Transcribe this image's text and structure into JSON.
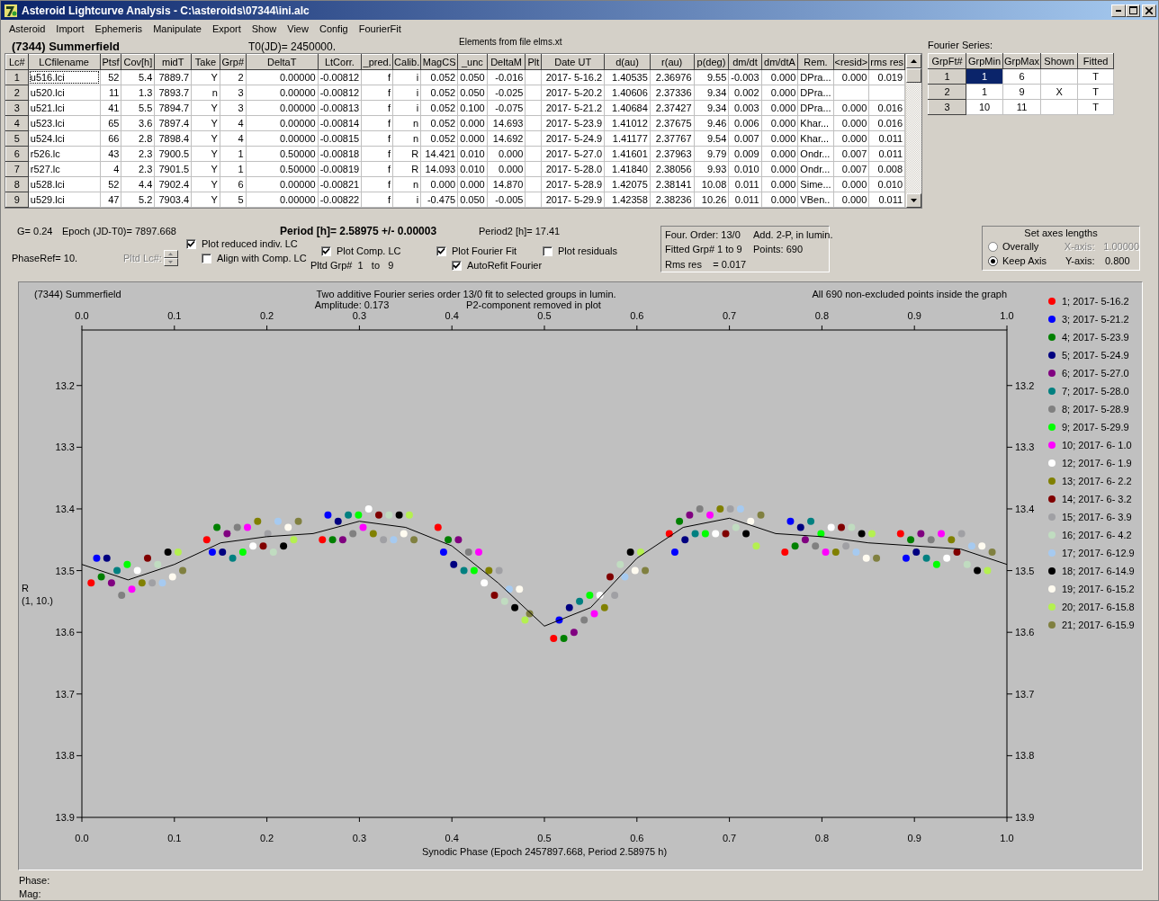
{
  "window": {
    "title": "Asteroid Lightcurve Analysis - C:\\asteroids\\07344\\ini.alc"
  },
  "menu": [
    "Asteroid",
    "Import",
    "Ephemeris",
    "Manipulate",
    "Export",
    "Show",
    "View",
    "Config",
    "FourierFit"
  ],
  "header": {
    "object": "(7344) Summerfield",
    "t0": "T0(JD)= 2450000.",
    "elements": "Elements from file elms.xt"
  },
  "lc_table": {
    "columns": [
      "Lc#",
      "LCfilename",
      "Ptsf",
      "Cov[h]",
      "midT",
      "Take",
      "Grp#",
      "DeltaT",
      "LtCorr.",
      "_pred.",
      "Calib.",
      "MagCS",
      "_unc",
      "DeltaM",
      "Plt",
      "Date UT",
      "d(au)",
      "r(au)",
      "p(deg)",
      "dm/dt",
      "dm/dtA",
      "Rem.",
      "<resid>",
      "rms res"
    ],
    "rows": [
      {
        "focused": true,
        "cells": [
          "1",
          "u516.lci",
          "52",
          "5.4",
          "7889.7",
          "Y",
          "2",
          "0.00000",
          "-0.00812",
          "f",
          "i",
          "0.052",
          "0.050",
          "-0.016",
          "",
          "2017- 5-16.2",
          "1.40535",
          "2.36976",
          "9.55",
          "-0.003",
          "0.000",
          "DPra...",
          "0.000",
          "0.019"
        ]
      },
      {
        "focused": false,
        "cells": [
          "2",
          "u520.lci",
          "11",
          "1.3",
          "7893.7",
          "n",
          "3",
          "0.00000",
          "-0.00812",
          "f",
          "i",
          "0.052",
          "0.050",
          "-0.025",
          "",
          "2017- 5-20.2",
          "1.40606",
          "2.37336",
          "9.34",
          "0.002",
          "0.000",
          "DPra..."
        ]
      },
      {
        "focused": false,
        "cells": [
          "3",
          "u521.lci",
          "41",
          "5.5",
          "7894.7",
          "Y",
          "3",
          "0.00000",
          "-0.00813",
          "f",
          "i",
          "0.052",
          "0.100",
          "-0.075",
          "",
          "2017- 5-21.2",
          "1.40684",
          "2.37427",
          "9.34",
          "0.003",
          "0.000",
          "DPra...",
          "0.000",
          "0.016"
        ]
      },
      {
        "focused": false,
        "cells": [
          "4",
          "u523.lci",
          "65",
          "3.6",
          "7897.4",
          "Y",
          "4",
          "0.00000",
          "-0.00814",
          "f",
          "n",
          "0.052",
          "0.000",
          "14.693",
          "",
          "2017- 5-23.9",
          "1.41012",
          "2.37675",
          "9.46",
          "0.006",
          "0.000",
          "Khar...",
          "0.000",
          "0.016"
        ]
      },
      {
        "focused": false,
        "cells": [
          "5",
          "u524.lci",
          "66",
          "2.8",
          "7898.4",
          "Y",
          "4",
          "0.00000",
          "-0.00815",
          "f",
          "n",
          "0.052",
          "0.000",
          "14.692",
          "",
          "2017- 5-24.9",
          "1.41177",
          "2.37767",
          "9.54",
          "0.007",
          "0.000",
          "Khar...",
          "0.000",
          "0.011"
        ]
      },
      {
        "focused": false,
        "cells": [
          "6",
          "r526.lc",
          "43",
          "2.3",
          "7900.5",
          "Y",
          "1",
          "0.50000",
          "-0.00818",
          "f",
          "R",
          "14.421",
          "0.010",
          "0.000",
          "",
          "2017- 5-27.0",
          "1.41601",
          "2.37963",
          "9.79",
          "0.009",
          "0.000",
          "Ondr...",
          "0.007",
          "0.011"
        ]
      },
      {
        "focused": false,
        "cells": [
          "7",
          "r527.lc",
          "4",
          "2.3",
          "7901.5",
          "Y",
          "1",
          "0.50000",
          "-0.00819",
          "f",
          "R",
          "14.093",
          "0.010",
          "0.000",
          "",
          "2017- 5-28.0",
          "1.41840",
          "2.38056",
          "9.93",
          "0.010",
          "0.000",
          "Ondr...",
          "0.007",
          "0.008"
        ]
      },
      {
        "focused": false,
        "cells": [
          "8",
          "u528.lci",
          "52",
          "4.4",
          "7902.4",
          "Y",
          "6",
          "0.00000",
          "-0.00821",
          "f",
          "n",
          "0.000",
          "0.000",
          "14.870",
          "",
          "2017- 5-28.9",
          "1.42075",
          "2.38141",
          "10.08",
          "0.011",
          "0.000",
          "Sime...",
          "0.000",
          "0.010"
        ]
      },
      {
        "focused": false,
        "cells": [
          "9",
          "u529.lci",
          "47",
          "5.2",
          "7903.4",
          "Y",
          "5",
          "0.00000",
          "-0.00822",
          "f",
          "i",
          "-0.475",
          "0.050",
          "-0.005",
          "",
          "2017- 5-29.9",
          "1.42358",
          "2.38236",
          "10.26",
          "0.011",
          "0.000",
          "VBen..",
          "0.000",
          "0.011"
        ]
      }
    ]
  },
  "fourier": {
    "label": "Fourier Series:",
    "columns": [
      "GrpFt#",
      "GrpMin",
      "GrpMax",
      "Shown",
      "Fitted"
    ],
    "rows": [
      {
        "num": "1",
        "min": "1",
        "max": "6",
        "fitted": "T",
        "selected": true
      },
      {
        "num": "2",
        "min": "1",
        "max": "9",
        "shown": "X",
        "fitted": "T",
        "selected": false
      },
      {
        "num": "3",
        "min": "10",
        "max": "11",
        "fitted": "T",
        "selected": false
      }
    ]
  },
  "stats": {
    "g": "G= 0.24",
    "epoch": "Epoch (JD-T0)= 7897.668",
    "period": "Period [h]= 2.58975 +/- 0.00003",
    "period2": "Period2 [h]= 17.41",
    "phaseref": "PhaseRef= 10.",
    "pltd_lc": {
      "label": "Pltd Lc#:",
      "disabled": true
    },
    "pltd_grp": "Pltd Grp#  1   to   9"
  },
  "checkboxes": [
    {
      "label": "Plot reduced indiv. LC",
      "checked": true
    },
    {
      "label": "Align with Comp. LC",
      "checked": false
    },
    {
      "label": "Plot Comp. LC",
      "checked": true
    },
    {
      "label": "Plot Fourier Fit",
      "checked": true
    },
    {
      "label": "Plot residuals",
      "checked": false
    },
    {
      "label": "AutoRefit Fourier",
      "checked": true
    }
  ],
  "info": [
    "Four. Order: 13/0",
    "Add. 2-P, in lumin.",
    "Fitted Grp# 1 to 9",
    "Points: 690",
    "Rms res    = 0.017"
  ],
  "axes": {
    "title": "Set axes lengths",
    "options": [
      {
        "label": "Overally",
        "selected": false
      },
      {
        "label": "Keep Axis",
        "selected": true
      }
    ],
    "fields": [
      {
        "label": "X-axis:",
        "value": "1.00000",
        "disabled": true
      },
      {
        "label": "Y-axis:",
        "value": "0.800",
        "disabled": false
      }
    ]
  },
  "panel": {
    "object": "(7344) Summerfield",
    "subtitle": "Amplitude: 0.173",
    "note_center": "P2-component removed in plot",
    "note_right": "All 690 non-excluded points inside the graph",
    "y_note": "(1, 10.)",
    "right_axis_labels": [
      "13.2",
      "13.3",
      "13.4",
      "13.5",
      "13.6",
      "13.7",
      "13.8",
      "13.9"
    ],
    "chart_data": {
      "type": "scatter",
      "title": "Two additive Fourier series order 13/0 fit to selected groups in lumin.",
      "xlabel": "Synodic Phase (Epoch 2457897.668, Period 2.58975 h)",
      "ylabel": "R",
      "legend": true,
      "xlim": [
        0,
        1
      ],
      "ylim": [
        13.9,
        13.11
      ],
      "xticks": [
        {
          "value": 0,
          "label": "0.0"
        },
        {
          "value": 0.1,
          "label": "0.1"
        },
        {
          "value": 0.2,
          "label": "0.2"
        },
        {
          "value": 0.3,
          "label": "0.3"
        },
        {
          "value": 0.4,
          "label": "0.4"
        },
        {
          "value": 0.5,
          "label": "0.5"
        },
        {
          "value": 0.6,
          "label": "0.6"
        },
        {
          "value": 0.7,
          "label": "0.7"
        },
        {
          "value": 0.8,
          "label": "0.8"
        },
        {
          "value": 0.9,
          "label": "0.9"
        },
        {
          "value": 1,
          "label": "1.0"
        }
      ],
      "yticks": [
        {
          "value": 13.2,
          "label": "13.2"
        },
        {
          "value": 13.3,
          "label": "13.3"
        },
        {
          "value": 13.4,
          "label": "13.4"
        },
        {
          "value": 13.5,
          "label": "13.5"
        },
        {
          "value": 13.6,
          "label": "13.6"
        },
        {
          "value": 13.7,
          "label": "13.7"
        },
        {
          "value": 13.8,
          "label": "13.8"
        },
        {
          "value": 13.9,
          "label": "13.9"
        }
      ],
      "series": [
        {
          "name": "1; 2017- 5-16.2",
          "color": "#ff0000",
          "x": [
            0.01,
            0.135,
            0.26,
            0.385,
            0.51,
            0.635,
            0.76,
            0.885
          ],
          "values": [
            13.52,
            13.45,
            13.45,
            13.43,
            13.61,
            13.44,
            13.47,
            13.44
          ]
        },
        {
          "name": "3; 2017- 5-21.2",
          "color": "#0000ff",
          "x": [
            0.016,
            0.141,
            0.266,
            0.391,
            0.516,
            0.641,
            0.766,
            0.891
          ],
          "values": [
            13.48,
            13.47,
            13.41,
            13.47,
            13.58,
            13.47,
            13.42,
            13.48
          ]
        },
        {
          "name": "4; 2017- 5-23.9",
          "color": "#008000",
          "x": [
            0.021,
            0.146,
            0.271,
            0.396,
            0.521,
            0.646,
            0.771,
            0.896
          ],
          "values": [
            13.51,
            13.43,
            13.45,
            13.45,
            13.61,
            13.42,
            13.46,
            13.45
          ]
        },
        {
          "name": "5; 2017- 5-24.9",
          "color": "#000080",
          "x": [
            0.027,
            0.152,
            0.277,
            0.402,
            0.527,
            0.652,
            0.777,
            0.902
          ],
          "values": [
            13.48,
            13.47,
            13.42,
            13.49,
            13.56,
            13.45,
            13.43,
            13.47
          ]
        },
        {
          "name": "6; 2017- 5-27.0",
          "color": "#800080",
          "x": [
            0.032,
            0.157,
            0.282,
            0.407,
            0.532,
            0.657,
            0.782,
            0.907
          ],
          "values": [
            13.52,
            13.44,
            13.45,
            13.45,
            13.6,
            13.41,
            13.45,
            13.44
          ]
        },
        {
          "name": "7; 2017- 5-28.0",
          "color": "#008080",
          "x": [
            0.038,
            0.163,
            0.288,
            0.413,
            0.538,
            0.663,
            0.788,
            0.913
          ],
          "values": [
            13.5,
            13.48,
            13.41,
            13.5,
            13.55,
            13.44,
            13.42,
            13.48
          ]
        },
        {
          "name": "8; 2017- 5-28.9",
          "color": "#808080",
          "x": [
            0.043,
            0.168,
            0.293,
            0.418,
            0.543,
            0.668,
            0.793,
            0.918
          ],
          "values": [
            13.54,
            13.43,
            13.44,
            13.47,
            13.58,
            13.4,
            13.46,
            13.45
          ]
        },
        {
          "name": "9; 2017- 5-29.9",
          "color": "#00ff00",
          "x": [
            0.049,
            0.174,
            0.299,
            0.424,
            0.549,
            0.674,
            0.799,
            0.924
          ],
          "values": [
            13.49,
            13.47,
            13.41,
            13.5,
            13.54,
            13.44,
            13.44,
            13.49
          ]
        },
        {
          "name": "10; 2017- 6- 1.0",
          "color": "#ff00ff",
          "x": [
            0.054,
            0.179,
            0.304,
            0.429,
            0.554,
            0.679,
            0.804,
            0.929
          ],
          "values": [
            13.53,
            13.43,
            13.43,
            13.47,
            13.57,
            13.41,
            13.47,
            13.44
          ]
        },
        {
          "name": "12; 2017- 6- 1.9",
          "color": "#ffffff",
          "x": [
            0.06,
            0.185,
            0.31,
            0.435,
            0.56,
            0.685,
            0.81,
            0.935
          ],
          "values": [
            13.5,
            13.46,
            13.4,
            13.52,
            13.54,
            13.44,
            13.43,
            13.48
          ]
        },
        {
          "name": "13; 2017- 6- 2.2",
          "color": "#808000",
          "x": [
            0.065,
            0.19,
            0.315,
            0.44,
            0.565,
            0.69,
            0.815,
            0.94
          ],
          "values": [
            13.52,
            13.42,
            13.44,
            13.5,
            13.56,
            13.4,
            13.47,
            13.45
          ]
        },
        {
          "name": "14; 2017- 6- 3.2",
          "color": "#800000",
          "x": [
            0.071,
            0.196,
            0.321,
            0.446,
            0.571,
            0.696,
            0.821,
            0.946
          ],
          "values": [
            13.48,
            13.46,
            13.41,
            13.54,
            13.51,
            13.44,
            13.43,
            13.47
          ]
        },
        {
          "name": "15; 2017- 6- 3.9",
          "color": "#a0a0a4",
          "x": [
            0.076,
            0.201,
            0.326,
            0.451,
            0.576,
            0.701,
            0.826,
            0.951
          ],
          "values": [
            13.52,
            13.44,
            13.45,
            13.5,
            13.54,
            13.4,
            13.46,
            13.44
          ]
        },
        {
          "name": "16; 2017- 6- 4.2",
          "color": "#c0dcc0",
          "x": [
            0.082,
            0.207,
            0.332,
            0.457,
            0.582,
            0.707,
            0.832,
            0.957
          ],
          "values": [
            13.49,
            13.47,
            13.41,
            13.55,
            13.49,
            13.43,
            13.43,
            13.49
          ]
        },
        {
          "name": "17; 2017- 6-12.9",
          "color": "#a6caf0",
          "x": [
            0.087,
            0.212,
            0.337,
            0.462,
            0.587,
            0.712,
            0.837,
            0.962
          ],
          "values": [
            13.52,
            13.42,
            13.45,
            13.53,
            13.51,
            13.4,
            13.47,
            13.46
          ]
        },
        {
          "name": "18; 2017- 6-14.9",
          "color": "#000000",
          "x": [
            0.093,
            0.218,
            0.343,
            0.468,
            0.593,
            0.718,
            0.843,
            0.968
          ],
          "values": [
            13.47,
            13.46,
            13.41,
            13.56,
            13.47,
            13.44,
            13.44,
            13.5
          ]
        },
        {
          "name": "19; 2017- 6-15.2",
          "color": "#fffbf0",
          "x": [
            0.098,
            0.223,
            0.348,
            0.473,
            0.598,
            0.723,
            0.848,
            0.973
          ],
          "values": [
            13.51,
            13.43,
            13.44,
            13.53,
            13.5,
            13.42,
            13.48,
            13.46
          ]
        },
        {
          "name": "20; 2017- 6-15.8",
          "color": "#b4f050",
          "x": [
            0.104,
            0.229,
            0.354,
            0.479,
            0.604,
            0.729,
            0.854,
            0.979
          ],
          "values": [
            13.47,
            13.45,
            13.41,
            13.58,
            13.47,
            13.46,
            13.44,
            13.5
          ]
        },
        {
          "name": "21; 2017- 6-15.9",
          "color": "#808040",
          "x": [
            0.109,
            0.234,
            0.359,
            0.484,
            0.609,
            0.734,
            0.859,
            0.984
          ],
          "values": [
            13.5,
            13.42,
            13.45,
            13.57,
            13.5,
            13.41,
            13.48,
            13.47
          ]
        },
        {
          "type": "line",
          "color": "#000000",
          "x": [
            0,
            0.05,
            0.1,
            0.15,
            0.2,
            0.25,
            0.3,
            0.35,
            0.4,
            0.45,
            0.5,
            0.55,
            0.6,
            0.65,
            0.7,
            0.75,
            0.8,
            0.85,
            0.9,
            0.95,
            1
          ],
          "values": [
            13.49,
            13.515,
            13.49,
            13.455,
            13.445,
            13.44,
            13.42,
            13.43,
            13.46,
            13.52,
            13.59,
            13.56,
            13.48,
            13.43,
            13.415,
            13.44,
            13.445,
            13.455,
            13.46,
            13.465,
            13.49
          ]
        }
      ]
    }
  },
  "readout": [
    "Phase:",
    "Mag:"
  ]
}
